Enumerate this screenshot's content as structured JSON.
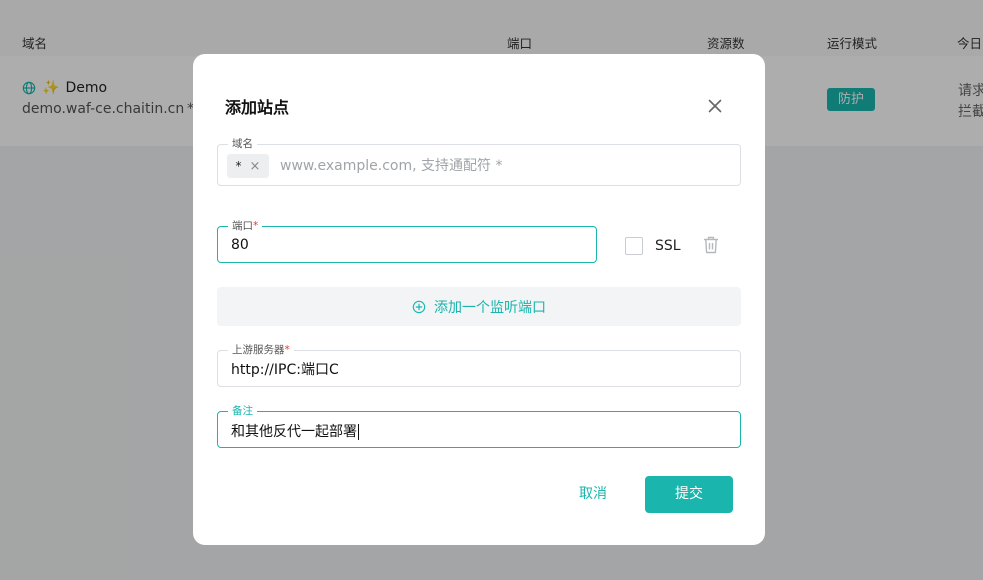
{
  "table": {
    "headers": {
      "domain": "域名",
      "port": "端口",
      "resources": "资源数",
      "mode": "运行模式",
      "today": "今日"
    },
    "row": {
      "name_sparkle": "✨",
      "name": "Demo",
      "host": "demo.waf-ce.chaitin.cn",
      "port_partial": "*",
      "mode_badge": "防护",
      "today_line1": "请求",
      "today_line2": "拦截"
    }
  },
  "dialog": {
    "title": "添加站点",
    "domain": {
      "legend": "域名",
      "chip": "*",
      "chip_remove": "×",
      "placeholder": "www.example.com, 支持通配符 *"
    },
    "port": {
      "legend": "端口",
      "required": "*",
      "value": "80",
      "ssl_label": "SSL",
      "ssl_checked": false
    },
    "add_port_label": "添加一个监听端口",
    "upstream": {
      "legend": "上游服务器",
      "required": "*",
      "value": "http://IPC:端口C"
    },
    "note": {
      "legend": "备注",
      "value": "和其他反代一起部署"
    },
    "cancel_label": "取消",
    "submit_label": "提交"
  },
  "colors": {
    "accent": "#1ab5ad",
    "required": "#e53935",
    "overlay": "rgba(0,0,0,0.32)"
  },
  "icons": [
    "globe-icon",
    "close-icon",
    "trash-icon",
    "plus-circle-icon",
    "chip-remove-icon"
  ]
}
